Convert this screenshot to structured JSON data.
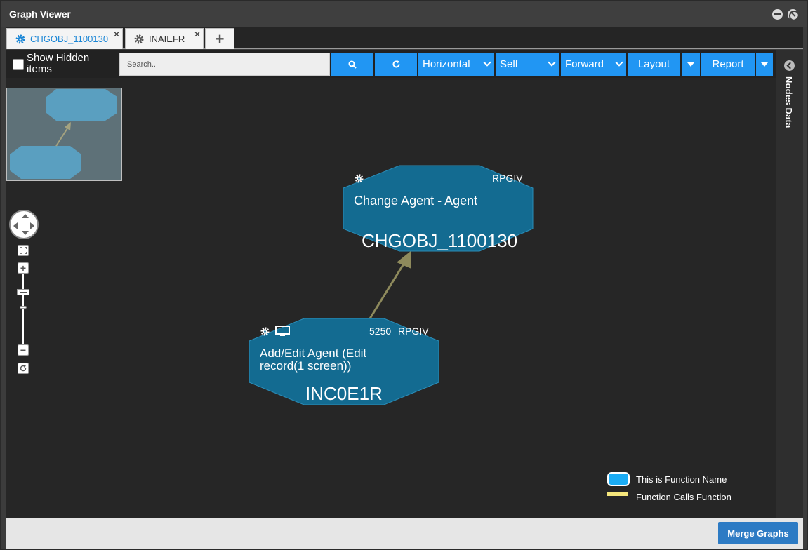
{
  "window": {
    "title": "Graph Viewer"
  },
  "tabs": [
    {
      "label": "CHGOBJ_1100130",
      "icon": "gear-icon",
      "active": true
    },
    {
      "label": "INAIEFR",
      "icon": "gear-icon",
      "active": false
    }
  ],
  "add_tab_label": "+",
  "toolbar": {
    "show_hidden_label": "Show Hidden items",
    "search_placeholder": "Search..",
    "direction": "Horizontal",
    "scope": "Self",
    "flow": "Forward",
    "layout_label": "Layout",
    "report_label": "Report"
  },
  "side_panel": {
    "label": "Nodes Data"
  },
  "graph": {
    "nodes": [
      {
        "id": "CHGOBJ_1100130",
        "description": "Change Agent - Agent",
        "language": "RPGIV",
        "number": "",
        "icons": [
          "gear-icon"
        ]
      },
      {
        "id": "INC0E1R",
        "description_line1": "Add/Edit Agent (Edit",
        "description_line2": "record(1 screen))",
        "language": "RPGIV",
        "number": "5250",
        "icons": [
          "gear-icon",
          "monitor-icon"
        ]
      }
    ],
    "edges": [
      {
        "from": "INC0E1R",
        "to": "CHGOBJ_1100130"
      }
    ]
  },
  "legend": {
    "node_label": "This is Function Name",
    "edge_label": "Function Calls Function",
    "node_color": "#1aacf5",
    "edge_color": "#f5e67c"
  },
  "footer": {
    "merge_label": "Merge Graphs"
  },
  "colors": {
    "node_fill": "#136b91",
    "edge": "#8e8a5c",
    "accent": "#2196f3"
  }
}
